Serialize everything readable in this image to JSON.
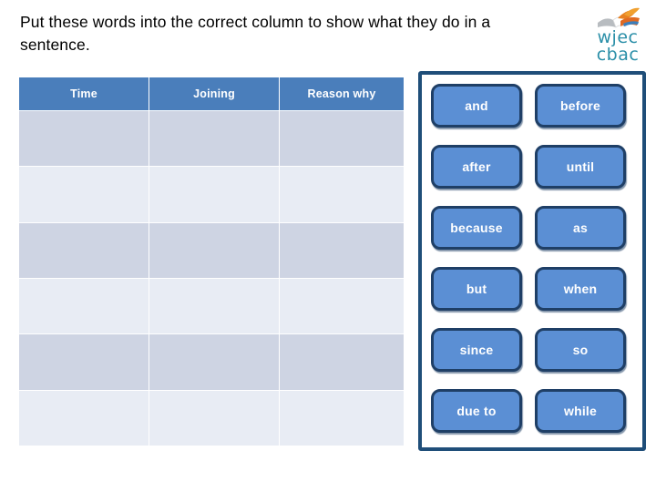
{
  "instruction": "Put these words into the correct column to show what they do in a sentence.",
  "logo": {
    "mark_name": "wjec-book-flame-icon",
    "line1": "wjec",
    "line2": "cbac",
    "color": "#2b8fa8"
  },
  "table": {
    "headers": [
      "Time",
      "Joining",
      "Reason why"
    ],
    "header_bg": "#4a7ebb",
    "header_text_color": "#ffffff",
    "row_colors": [
      "#ced4e3",
      "#e8ecf4"
    ],
    "rows": [
      [
        "",
        "",
        ""
      ],
      [
        "",
        "",
        ""
      ],
      [
        "",
        "",
        ""
      ],
      [
        "",
        "",
        ""
      ],
      [
        "",
        "",
        ""
      ],
      [
        "",
        "",
        ""
      ]
    ]
  },
  "word_bank": {
    "border_color": "#1f4e79",
    "box_bg": "#5b8fd4",
    "box_border": "#1f3f66",
    "box_text_color": "#ffffff",
    "words": [
      "and",
      "before",
      "after",
      "until",
      "because",
      "as",
      "but",
      "when",
      "since",
      "so",
      "due to",
      "while"
    ]
  }
}
